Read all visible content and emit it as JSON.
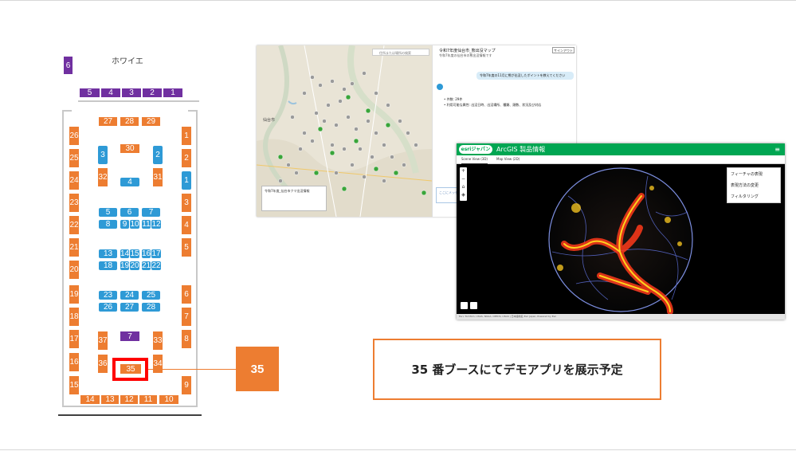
{
  "floor_plan": {
    "foyer_label": "ホワイエ",
    "booths": {
      "b6": "6",
      "b5": "5",
      "b4": "4",
      "b3": "3",
      "b2": "2",
      "b1": "1",
      "t27": "27",
      "t28": "28",
      "t29": "29",
      "l26": "26",
      "l25": "25",
      "l24": "24",
      "l23": "23",
      "l22": "22",
      "l21": "21",
      "l20": "20",
      "l19": "19",
      "l18": "18",
      "l17": "17",
      "l16": "16",
      "l15": "15",
      "r1": "1",
      "r2": "2",
      "r3": "3",
      "r4": "4",
      "r5": "5",
      "r6": "6",
      "r7": "7",
      "r8": "8",
      "r9": "9",
      "c30": "30",
      "c32": "32",
      "c31": "31",
      "i3": "3",
      "i2": "2",
      "i1": "1",
      "i4": "4",
      "i5": "5",
      "i6": "6",
      "i7": "7",
      "i8": "8",
      "i9": "9",
      "i10": "10",
      "i11": "11",
      "i12": "12",
      "i13": "13",
      "i14": "14",
      "i15": "15",
      "i16": "16",
      "i17": "17",
      "i18": "18",
      "i19": "19",
      "i20": "20",
      "i21": "21",
      "i22": "22",
      "i23": "23",
      "i24": "24",
      "i25": "25",
      "i26": "26",
      "i27": "27",
      "i28": "28",
      "p7": "7",
      "c37": "37",
      "c33": "33",
      "c36": "36",
      "c34": "34",
      "c35": "35",
      "f14": "14",
      "f13": "13",
      "f12": "12",
      "f11": "11",
      "f10": "10"
    }
  },
  "callout": {
    "booth_number": "35"
  },
  "note": {
    "text": "35 番ブースにてデモアプリを展示予定"
  },
  "screenshot_map_app": {
    "search_placeholder": "住所または場所の検索",
    "panel_title": "令和7年度仙台市_熊出没マップ",
    "panel_subtitle": "令和7年度の仙台市の熊出没情報です",
    "signin": "サインアウト",
    "user_question": "令和7年度の11月に熊が出没したポイントを教えてください",
    "answer_lines": [
      "• 件数: 29件",
      "• 利用可能な属性: 出没日時、出没場所、種類、頭数、状況及び対応"
    ],
    "input_placeholder": "ここにメッセージを入力...",
    "infobox_title": "令和7年度_仙台市クマ出没情報",
    "city_label": "仙台市"
  },
  "screenshot_arcgis": {
    "logo": "esriジャパン",
    "title": "ArcGIS 製品情報",
    "tabs": [
      "Scene View (3D)",
      "Map View (2D)"
    ],
    "options": [
      "フィーチャの表現",
      "表現方法の変更",
      "フィルタリング"
    ],
    "attribution": "Esri, TomTom, USGS, NOAA, CEEDS, USGS | 日本語地名 Esri Japan, Powered by Esri"
  },
  "colors": {
    "orange": "#ed7d31",
    "blue": "#2e9ad6",
    "purple": "#7030a0",
    "highlight": "#ff0000",
    "esri_green": "#00a652"
  }
}
